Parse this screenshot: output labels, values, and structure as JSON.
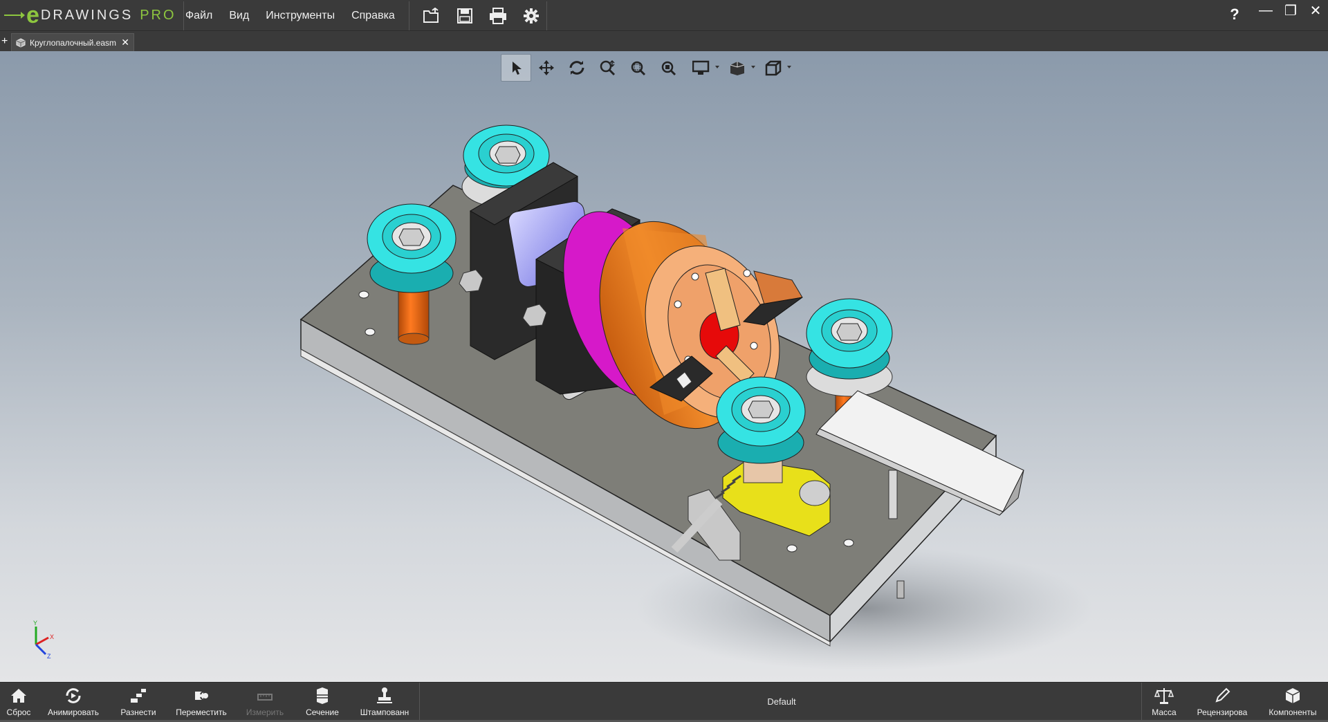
{
  "app": {
    "logo_e": "e",
    "logo_word": "DRAWINGS",
    "logo_pro": "PRO"
  },
  "menu": [
    "Файл",
    "Вид",
    "Инструменты",
    "Справка"
  ],
  "quick_tools": [
    "open-icon",
    "save-icon",
    "print-icon",
    "settings-icon"
  ],
  "window": {
    "help": "?",
    "minimize": "—",
    "restore": "❐",
    "close": "✕"
  },
  "tab": {
    "new": "+",
    "title": "Круглопалочный.easm",
    "close": "✕"
  },
  "view_tools": [
    "select-icon",
    "pan-icon",
    "rotate-icon",
    "zoom-icon",
    "zoom-area-icon",
    "zoom-to-fit-icon",
    "display-style-icon",
    "view-orientation-icon",
    "standard-views-icon"
  ],
  "triad": {
    "x": "X",
    "y": "Y",
    "z": "Z"
  },
  "bottom": {
    "reset": "Сброс",
    "animate": "Анимировать",
    "explode": "Разнести",
    "move": "Переместить",
    "measure": "Измерить",
    "section": "Сечение",
    "stamp": "Штампованн",
    "config": "Default",
    "mass": "Масса",
    "review": "Рецензирова",
    "components": "Компоненты"
  },
  "colors": {
    "accent": "#8dc63f",
    "cyan_pulley": "#35e3e3",
    "orange": "#e07a1a",
    "magenta": "#d619c9",
    "yellow": "#e8e01a"
  }
}
